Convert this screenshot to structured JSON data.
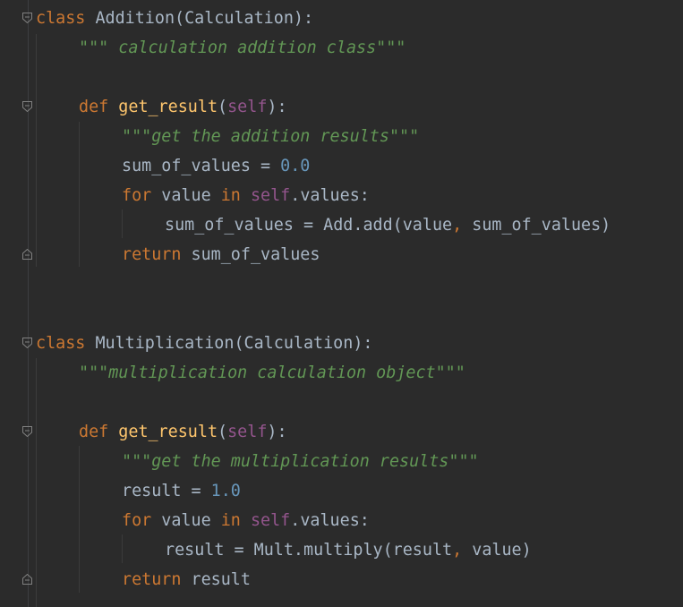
{
  "editor": {
    "theme_colors": {
      "background": "#2b2b2b",
      "default_text": "#a9b7c6",
      "keyword": "#cc7832",
      "function_name": "#ffc66d",
      "self": "#94558d",
      "number": "#6897bb",
      "docstring": "#629755"
    },
    "lines": {
      "l1": {
        "kw": "class",
        "text": " Addition(Calculation):"
      },
      "l2": {
        "doc": "\"\"\" calculation addition class\"\"\""
      },
      "l4": {
        "kw": "def",
        "fn": "get_result",
        "p_open": "(",
        "self": "self",
        "p_close": "):"
      },
      "l5": {
        "doc": "\"\"\"get the addition results\"\"\""
      },
      "l6": {
        "text": "sum_of_values = ",
        "num": "0.0"
      },
      "l7": {
        "kw": "for",
        "t1": " value ",
        "kw2": "in",
        "t2": " ",
        "self": "self",
        "t3": ".values:"
      },
      "l8": {
        "t1": "sum_of_values = Add.add(value",
        "comma": ",",
        "t2": " sum_of_values)"
      },
      "l9": {
        "kw": "return",
        "text": " sum_of_values"
      },
      "l12": {
        "kw": "class",
        "text": " Multiplication(Calculation):"
      },
      "l13": {
        "doc": "\"\"\"multiplication calculation object\"\"\""
      },
      "l15": {
        "kw": "def",
        "fn": "get_result",
        "p_open": "(",
        "self": "self",
        "p_close": "):"
      },
      "l16": {
        "doc": "\"\"\"get the multiplication results\"\"\""
      },
      "l17": {
        "text": "result = ",
        "num": "1.0"
      },
      "l18": {
        "kw": "for",
        "t1": " value ",
        "kw2": "in",
        "t2": " ",
        "self": "self",
        "t3": ".values:"
      },
      "l19": {
        "t1": "result = Mult.multiply(result",
        "comma": ",",
        "t2": " value)"
      },
      "l20": {
        "kw": "return",
        "text": " result"
      }
    }
  }
}
